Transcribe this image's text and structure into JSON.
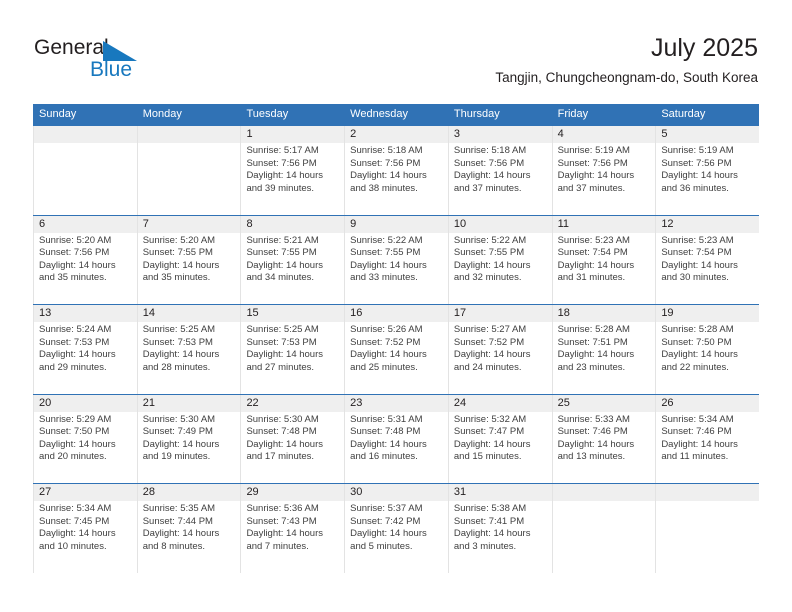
{
  "brand": {
    "name_part1": "General",
    "name_part2": "Blue",
    "flag_icon": "triangle-flag-icon",
    "color_primary": "#1878be",
    "color_text": "#231f20"
  },
  "header": {
    "title": "July 2025",
    "location": "Tangjin, Chungcheongnam-do, South Korea"
  },
  "calendar": {
    "accent_color": "#3072b5",
    "daynum_band_color": "#efefef",
    "weekday_headers": [
      "Sunday",
      "Monday",
      "Tuesday",
      "Wednesday",
      "Thursday",
      "Friday",
      "Saturday"
    ],
    "weeks": [
      [
        {
          "day": "",
          "sunrise": "",
          "sunset": "",
          "daylight_line1": "",
          "daylight_line2": ""
        },
        {
          "day": "",
          "sunrise": "",
          "sunset": "",
          "daylight_line1": "",
          "daylight_line2": ""
        },
        {
          "day": "1",
          "sunrise": "Sunrise: 5:17 AM",
          "sunset": "Sunset: 7:56 PM",
          "daylight_line1": "Daylight: 14 hours",
          "daylight_line2": "and 39 minutes."
        },
        {
          "day": "2",
          "sunrise": "Sunrise: 5:18 AM",
          "sunset": "Sunset: 7:56 PM",
          "daylight_line1": "Daylight: 14 hours",
          "daylight_line2": "and 38 minutes."
        },
        {
          "day": "3",
          "sunrise": "Sunrise: 5:18 AM",
          "sunset": "Sunset: 7:56 PM",
          "daylight_line1": "Daylight: 14 hours",
          "daylight_line2": "and 37 minutes."
        },
        {
          "day": "4",
          "sunrise": "Sunrise: 5:19 AM",
          "sunset": "Sunset: 7:56 PM",
          "daylight_line1": "Daylight: 14 hours",
          "daylight_line2": "and 37 minutes."
        },
        {
          "day": "5",
          "sunrise": "Sunrise: 5:19 AM",
          "sunset": "Sunset: 7:56 PM",
          "daylight_line1": "Daylight: 14 hours",
          "daylight_line2": "and 36 minutes."
        }
      ],
      [
        {
          "day": "6",
          "sunrise": "Sunrise: 5:20 AM",
          "sunset": "Sunset: 7:56 PM",
          "daylight_line1": "Daylight: 14 hours",
          "daylight_line2": "and 35 minutes."
        },
        {
          "day": "7",
          "sunrise": "Sunrise: 5:20 AM",
          "sunset": "Sunset: 7:55 PM",
          "daylight_line1": "Daylight: 14 hours",
          "daylight_line2": "and 35 minutes."
        },
        {
          "day": "8",
          "sunrise": "Sunrise: 5:21 AM",
          "sunset": "Sunset: 7:55 PM",
          "daylight_line1": "Daylight: 14 hours",
          "daylight_line2": "and 34 minutes."
        },
        {
          "day": "9",
          "sunrise": "Sunrise: 5:22 AM",
          "sunset": "Sunset: 7:55 PM",
          "daylight_line1": "Daylight: 14 hours",
          "daylight_line2": "and 33 minutes."
        },
        {
          "day": "10",
          "sunrise": "Sunrise: 5:22 AM",
          "sunset": "Sunset: 7:55 PM",
          "daylight_line1": "Daylight: 14 hours",
          "daylight_line2": "and 32 minutes."
        },
        {
          "day": "11",
          "sunrise": "Sunrise: 5:23 AM",
          "sunset": "Sunset: 7:54 PM",
          "daylight_line1": "Daylight: 14 hours",
          "daylight_line2": "and 31 minutes."
        },
        {
          "day": "12",
          "sunrise": "Sunrise: 5:23 AM",
          "sunset": "Sunset: 7:54 PM",
          "daylight_line1": "Daylight: 14 hours",
          "daylight_line2": "and 30 minutes."
        }
      ],
      [
        {
          "day": "13",
          "sunrise": "Sunrise: 5:24 AM",
          "sunset": "Sunset: 7:53 PM",
          "daylight_line1": "Daylight: 14 hours",
          "daylight_line2": "and 29 minutes."
        },
        {
          "day": "14",
          "sunrise": "Sunrise: 5:25 AM",
          "sunset": "Sunset: 7:53 PM",
          "daylight_line1": "Daylight: 14 hours",
          "daylight_line2": "and 28 minutes."
        },
        {
          "day": "15",
          "sunrise": "Sunrise: 5:25 AM",
          "sunset": "Sunset: 7:53 PM",
          "daylight_line1": "Daylight: 14 hours",
          "daylight_line2": "and 27 minutes."
        },
        {
          "day": "16",
          "sunrise": "Sunrise: 5:26 AM",
          "sunset": "Sunset: 7:52 PM",
          "daylight_line1": "Daylight: 14 hours",
          "daylight_line2": "and 25 minutes."
        },
        {
          "day": "17",
          "sunrise": "Sunrise: 5:27 AM",
          "sunset": "Sunset: 7:52 PM",
          "daylight_line1": "Daylight: 14 hours",
          "daylight_line2": "and 24 minutes."
        },
        {
          "day": "18",
          "sunrise": "Sunrise: 5:28 AM",
          "sunset": "Sunset: 7:51 PM",
          "daylight_line1": "Daylight: 14 hours",
          "daylight_line2": "and 23 minutes."
        },
        {
          "day": "19",
          "sunrise": "Sunrise: 5:28 AM",
          "sunset": "Sunset: 7:50 PM",
          "daylight_line1": "Daylight: 14 hours",
          "daylight_line2": "and 22 minutes."
        }
      ],
      [
        {
          "day": "20",
          "sunrise": "Sunrise: 5:29 AM",
          "sunset": "Sunset: 7:50 PM",
          "daylight_line1": "Daylight: 14 hours",
          "daylight_line2": "and 20 minutes."
        },
        {
          "day": "21",
          "sunrise": "Sunrise: 5:30 AM",
          "sunset": "Sunset: 7:49 PM",
          "daylight_line1": "Daylight: 14 hours",
          "daylight_line2": "and 19 minutes."
        },
        {
          "day": "22",
          "sunrise": "Sunrise: 5:30 AM",
          "sunset": "Sunset: 7:48 PM",
          "daylight_line1": "Daylight: 14 hours",
          "daylight_line2": "and 17 minutes."
        },
        {
          "day": "23",
          "sunrise": "Sunrise: 5:31 AM",
          "sunset": "Sunset: 7:48 PM",
          "daylight_line1": "Daylight: 14 hours",
          "daylight_line2": "and 16 minutes."
        },
        {
          "day": "24",
          "sunrise": "Sunrise: 5:32 AM",
          "sunset": "Sunset: 7:47 PM",
          "daylight_line1": "Daylight: 14 hours",
          "daylight_line2": "and 15 minutes."
        },
        {
          "day": "25",
          "sunrise": "Sunrise: 5:33 AM",
          "sunset": "Sunset: 7:46 PM",
          "daylight_line1": "Daylight: 14 hours",
          "daylight_line2": "and 13 minutes."
        },
        {
          "day": "26",
          "sunrise": "Sunrise: 5:34 AM",
          "sunset": "Sunset: 7:46 PM",
          "daylight_line1": "Daylight: 14 hours",
          "daylight_line2": "and 11 minutes."
        }
      ],
      [
        {
          "day": "27",
          "sunrise": "Sunrise: 5:34 AM",
          "sunset": "Sunset: 7:45 PM",
          "daylight_line1": "Daylight: 14 hours",
          "daylight_line2": "and 10 minutes."
        },
        {
          "day": "28",
          "sunrise": "Sunrise: 5:35 AM",
          "sunset": "Sunset: 7:44 PM",
          "daylight_line1": "Daylight: 14 hours",
          "daylight_line2": "and 8 minutes."
        },
        {
          "day": "29",
          "sunrise": "Sunrise: 5:36 AM",
          "sunset": "Sunset: 7:43 PM",
          "daylight_line1": "Daylight: 14 hours",
          "daylight_line2": "and 7 minutes."
        },
        {
          "day": "30",
          "sunrise": "Sunrise: 5:37 AM",
          "sunset": "Sunset: 7:42 PM",
          "daylight_line1": "Daylight: 14 hours",
          "daylight_line2": "and 5 minutes."
        },
        {
          "day": "31",
          "sunrise": "Sunrise: 5:38 AM",
          "sunset": "Sunset: 7:41 PM",
          "daylight_line1": "Daylight: 14 hours",
          "daylight_line2": "and 3 minutes."
        },
        {
          "day": "",
          "sunrise": "",
          "sunset": "",
          "daylight_line1": "",
          "daylight_line2": ""
        },
        {
          "day": "",
          "sunrise": "",
          "sunset": "",
          "daylight_line1": "",
          "daylight_line2": ""
        }
      ]
    ]
  }
}
